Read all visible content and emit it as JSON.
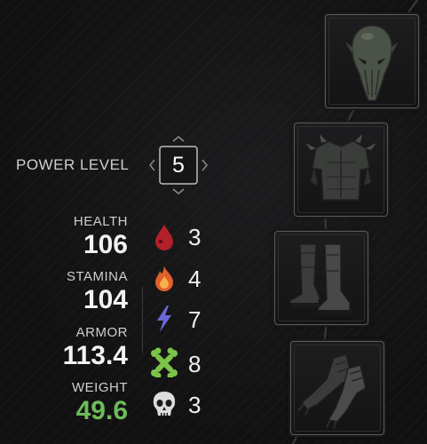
{
  "power_level": {
    "label": "POWER LEVEL",
    "value": "5"
  },
  "stats": [
    {
      "label": "HEALTH",
      "value": "106",
      "highlight": false
    },
    {
      "label": "STAMINA",
      "value": "104",
      "highlight": false
    },
    {
      "label": "ARMOR",
      "value": "113.4",
      "highlight": false
    },
    {
      "label": "WEIGHT",
      "value": "49.6",
      "highlight": true
    }
  ],
  "resistances": [
    {
      "icon": "blood-drop-icon",
      "value": "3",
      "color": "#b3202a"
    },
    {
      "icon": "fire-icon",
      "value": "4",
      "color": "#e0612a"
    },
    {
      "icon": "lightning-icon",
      "value": "7",
      "color": "#6c68d8"
    },
    {
      "icon": "bone-icon",
      "value": "8",
      "color": "#7cc34a"
    },
    {
      "icon": "skull-icon",
      "value": "3",
      "color": "#d8d8d8"
    }
  ],
  "equipment": [
    {
      "slot": "head",
      "icon": "helmet-icon"
    },
    {
      "slot": "chest",
      "icon": "chest-armor-icon"
    },
    {
      "slot": "legs",
      "icon": "boots-icon"
    },
    {
      "slot": "hands",
      "icon": "gauntlets-icon"
    }
  ],
  "colors": {
    "weight_value": "#6dbb5a",
    "background": "#121213"
  }
}
